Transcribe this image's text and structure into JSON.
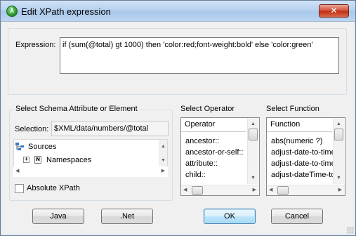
{
  "window": {
    "title": "Edit XPath expression",
    "close_glyph": "✕",
    "app_icon_glyph": "λ"
  },
  "expression": {
    "label": "Expression:",
    "value": "if (sum(@total) gt 1000) then 'color:red;font-weight:bold' else 'color:green'"
  },
  "schema": {
    "caption": "Select Schema Attribute or Element",
    "selection_label": "Selection:",
    "selection_value": "$XML/data/numbers/@total",
    "tree": [
      {
        "label": "Sources",
        "icon": "sources-icon"
      },
      {
        "label": "Namespaces",
        "icon": "namespace-icon",
        "ns_glyph": "N",
        "expander": "+"
      }
    ],
    "absolute_xpath_label": "Absolute XPath",
    "absolute_xpath_checked": false
  },
  "operator": {
    "caption": "Select Operator",
    "header": "Operator",
    "items": [
      "ancestor::",
      "ancestor-or-self::",
      "attribute::",
      "child::"
    ]
  },
  "function": {
    "caption": "Select Function",
    "header": "Function",
    "items": [
      "abs(numeric ?)",
      "adjust-date-to-time",
      "adjust-date-to-time",
      "adjust-dateTime-to"
    ]
  },
  "buttons": {
    "java": "Java",
    "net": ".Net",
    "ok": "OK",
    "cancel": "Cancel"
  },
  "scroll_glyphs": {
    "up": "▲",
    "down": "▼",
    "left": "◀",
    "right": "▶"
  }
}
